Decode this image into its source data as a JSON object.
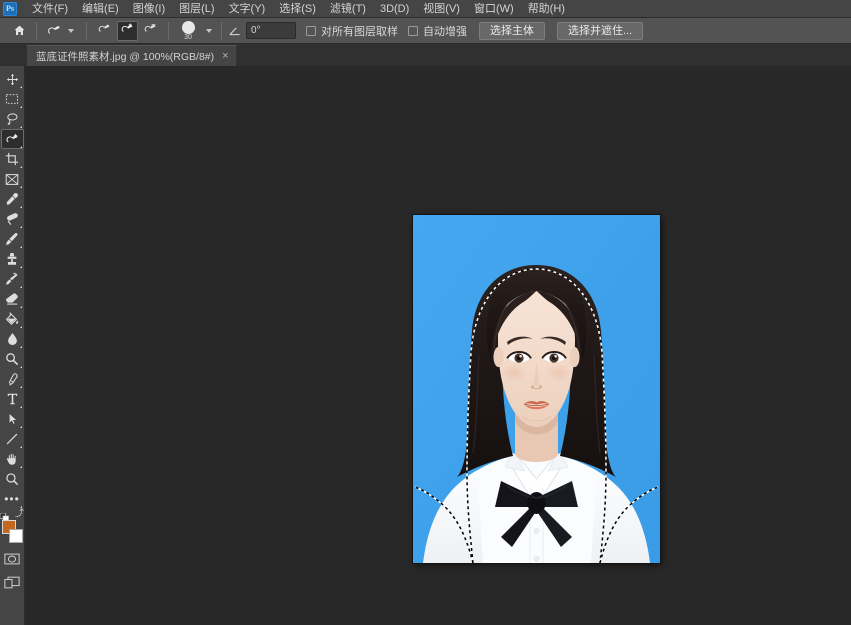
{
  "app": {
    "name": "Adobe Photoshop",
    "logo_text": "Ps",
    "theme_bg": "#1e1e1e",
    "panel_bg": "#454545",
    "canvas_bg": "#282828"
  },
  "menubar": {
    "items": [
      {
        "label": "文件(F)",
        "name": "menu-file"
      },
      {
        "label": "编辑(E)",
        "name": "menu-edit"
      },
      {
        "label": "图像(I)",
        "name": "menu-image"
      },
      {
        "label": "图层(L)",
        "name": "menu-layer"
      },
      {
        "label": "文字(Y)",
        "name": "menu-type"
      },
      {
        "label": "选择(S)",
        "name": "menu-select"
      },
      {
        "label": "滤镜(T)",
        "name": "menu-filter"
      },
      {
        "label": "3D(D)",
        "name": "menu-3d"
      },
      {
        "label": "视图(V)",
        "name": "menu-view"
      },
      {
        "label": "窗口(W)",
        "name": "menu-window"
      },
      {
        "label": "帮助(H)",
        "name": "menu-help"
      }
    ]
  },
  "options_bar": {
    "tool": "快速选择工具",
    "home_icon": "home-icon",
    "preset_icon": "quick-selection-tool-icon",
    "modes": [
      {
        "name": "selection-mode-new",
        "icon": "quick-select-new-icon",
        "active": false
      },
      {
        "name": "selection-mode-add",
        "icon": "quick-select-add-icon",
        "active": true
      },
      {
        "name": "selection-mode-subtract",
        "icon": "quick-select-subtract-icon",
        "active": false
      }
    ],
    "brush_size": "30",
    "angle_value": "0°",
    "checkboxes": [
      {
        "label": "对所有图层取样",
        "checked": false,
        "name": "sample-all-layers-checkbox"
      },
      {
        "label": "自动增强",
        "checked": false,
        "name": "auto-enhance-checkbox"
      }
    ],
    "buttons": [
      {
        "label": "选择主体",
        "name": "select-subject-button"
      },
      {
        "label": "选择并遮住...",
        "name": "select-and-mask-button"
      }
    ]
  },
  "tabbar": {
    "tabs": [
      {
        "title": "蓝底证件照素材.jpg @ 100%(RGB/8#)",
        "close_glyph": "×",
        "active": true
      }
    ]
  },
  "toolbar": {
    "tools": [
      {
        "name": "move-tool",
        "icon": "move-icon",
        "active": false
      },
      {
        "name": "rectangular-marquee-tool",
        "icon": "marquee-icon",
        "active": false
      },
      {
        "name": "lasso-tool",
        "icon": "lasso-icon",
        "active": false
      },
      {
        "name": "quick-selection-tool",
        "icon": "quick-selection-icon",
        "active": true
      },
      {
        "name": "crop-tool",
        "icon": "crop-icon",
        "active": false
      },
      {
        "name": "frame-tool",
        "icon": "frame-icon",
        "active": false
      },
      {
        "name": "eyedropper-tool",
        "icon": "eyedropper-icon",
        "active": false
      },
      {
        "name": "spot-healing-brush-tool",
        "icon": "healing-brush-icon",
        "active": false
      },
      {
        "name": "brush-tool",
        "icon": "brush-icon",
        "active": false
      },
      {
        "name": "clone-stamp-tool",
        "icon": "clone-stamp-icon",
        "active": false
      },
      {
        "name": "history-brush-tool",
        "icon": "history-brush-icon",
        "active": false
      },
      {
        "name": "eraser-tool",
        "icon": "eraser-icon",
        "active": false
      },
      {
        "name": "gradient-tool",
        "icon": "paint-bucket-icon",
        "active": false
      },
      {
        "name": "blur-tool",
        "icon": "blur-drop-icon",
        "active": false
      },
      {
        "name": "dodge-tool",
        "icon": "dodge-icon",
        "active": false
      },
      {
        "name": "pen-tool",
        "icon": "pen-icon",
        "active": false
      },
      {
        "name": "type-tool",
        "icon": "type-T-icon",
        "active": false
      },
      {
        "name": "path-selection-tool",
        "icon": "path-arrow-icon",
        "active": false
      },
      {
        "name": "line-shape-tool",
        "icon": "line-icon",
        "active": false
      },
      {
        "name": "hand-tool",
        "icon": "hand-icon",
        "active": false
      },
      {
        "name": "zoom-tool",
        "icon": "magnifier-icon",
        "active": false
      },
      {
        "name": "edit-toolbar-button",
        "icon": "ellipsis-icon",
        "active": false
      }
    ],
    "color": {
      "foreground": "#c2691f",
      "background": "#ffffff",
      "swap_icon": "swap-colors-icon",
      "default_icon": "default-colors-icon"
    },
    "quick_mask": {
      "name": "quick-mask-toggle",
      "icon": "quick-mask-icon"
    },
    "screen_mode": {
      "name": "screen-mode-button",
      "icon": "screen-mode-icon"
    }
  },
  "document": {
    "file_name": "蓝底证件照素材.jpg",
    "zoom": "100%",
    "color_mode": "RGB/8#",
    "background_color": "#3fa2ec",
    "shirt_color": "#ffffff",
    "hair_color": "#231a18",
    "bowtie_color": "#17171b",
    "selection_active": true,
    "selection_name": "marching-ants-selection"
  }
}
